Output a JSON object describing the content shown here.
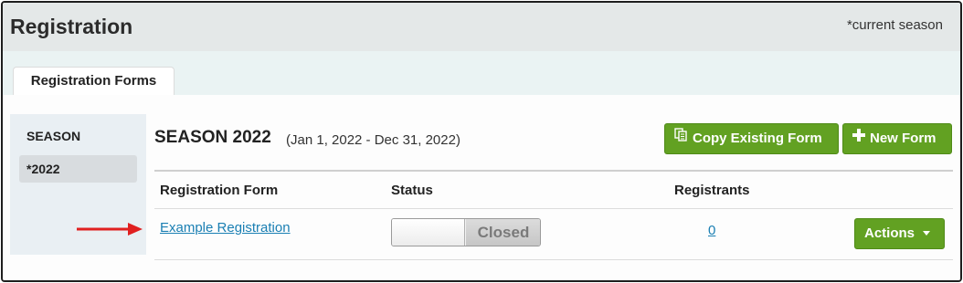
{
  "header": {
    "title": "Registration",
    "note": "*current season"
  },
  "tabs": [
    {
      "label": "Registration Forms",
      "active": true
    }
  ],
  "sidebar": {
    "heading": "SEASON",
    "items": [
      {
        "label": "*2022",
        "selected": true
      }
    ]
  },
  "main": {
    "season_title": "SEASON 2022",
    "season_range": "(Jan 1, 2022 - Dec 31, 2022)",
    "buttons": {
      "copy_label": "Copy Existing Form",
      "new_label": "New Form"
    },
    "table": {
      "columns": [
        "Registration Form",
        "Status",
        "Registrants"
      ],
      "rows": [
        {
          "form_name": "Example Registration",
          "status": "Closed",
          "registrants": "0",
          "actions_label": "Actions"
        }
      ]
    }
  },
  "colors": {
    "accent_green": "#62a122",
    "link_blue": "#1a7fb3",
    "annotation_red": "#e02020"
  },
  "icons": {
    "copy_button": "copy-icon",
    "new_button": "plus-icon",
    "actions_button": "caret-down-icon"
  }
}
